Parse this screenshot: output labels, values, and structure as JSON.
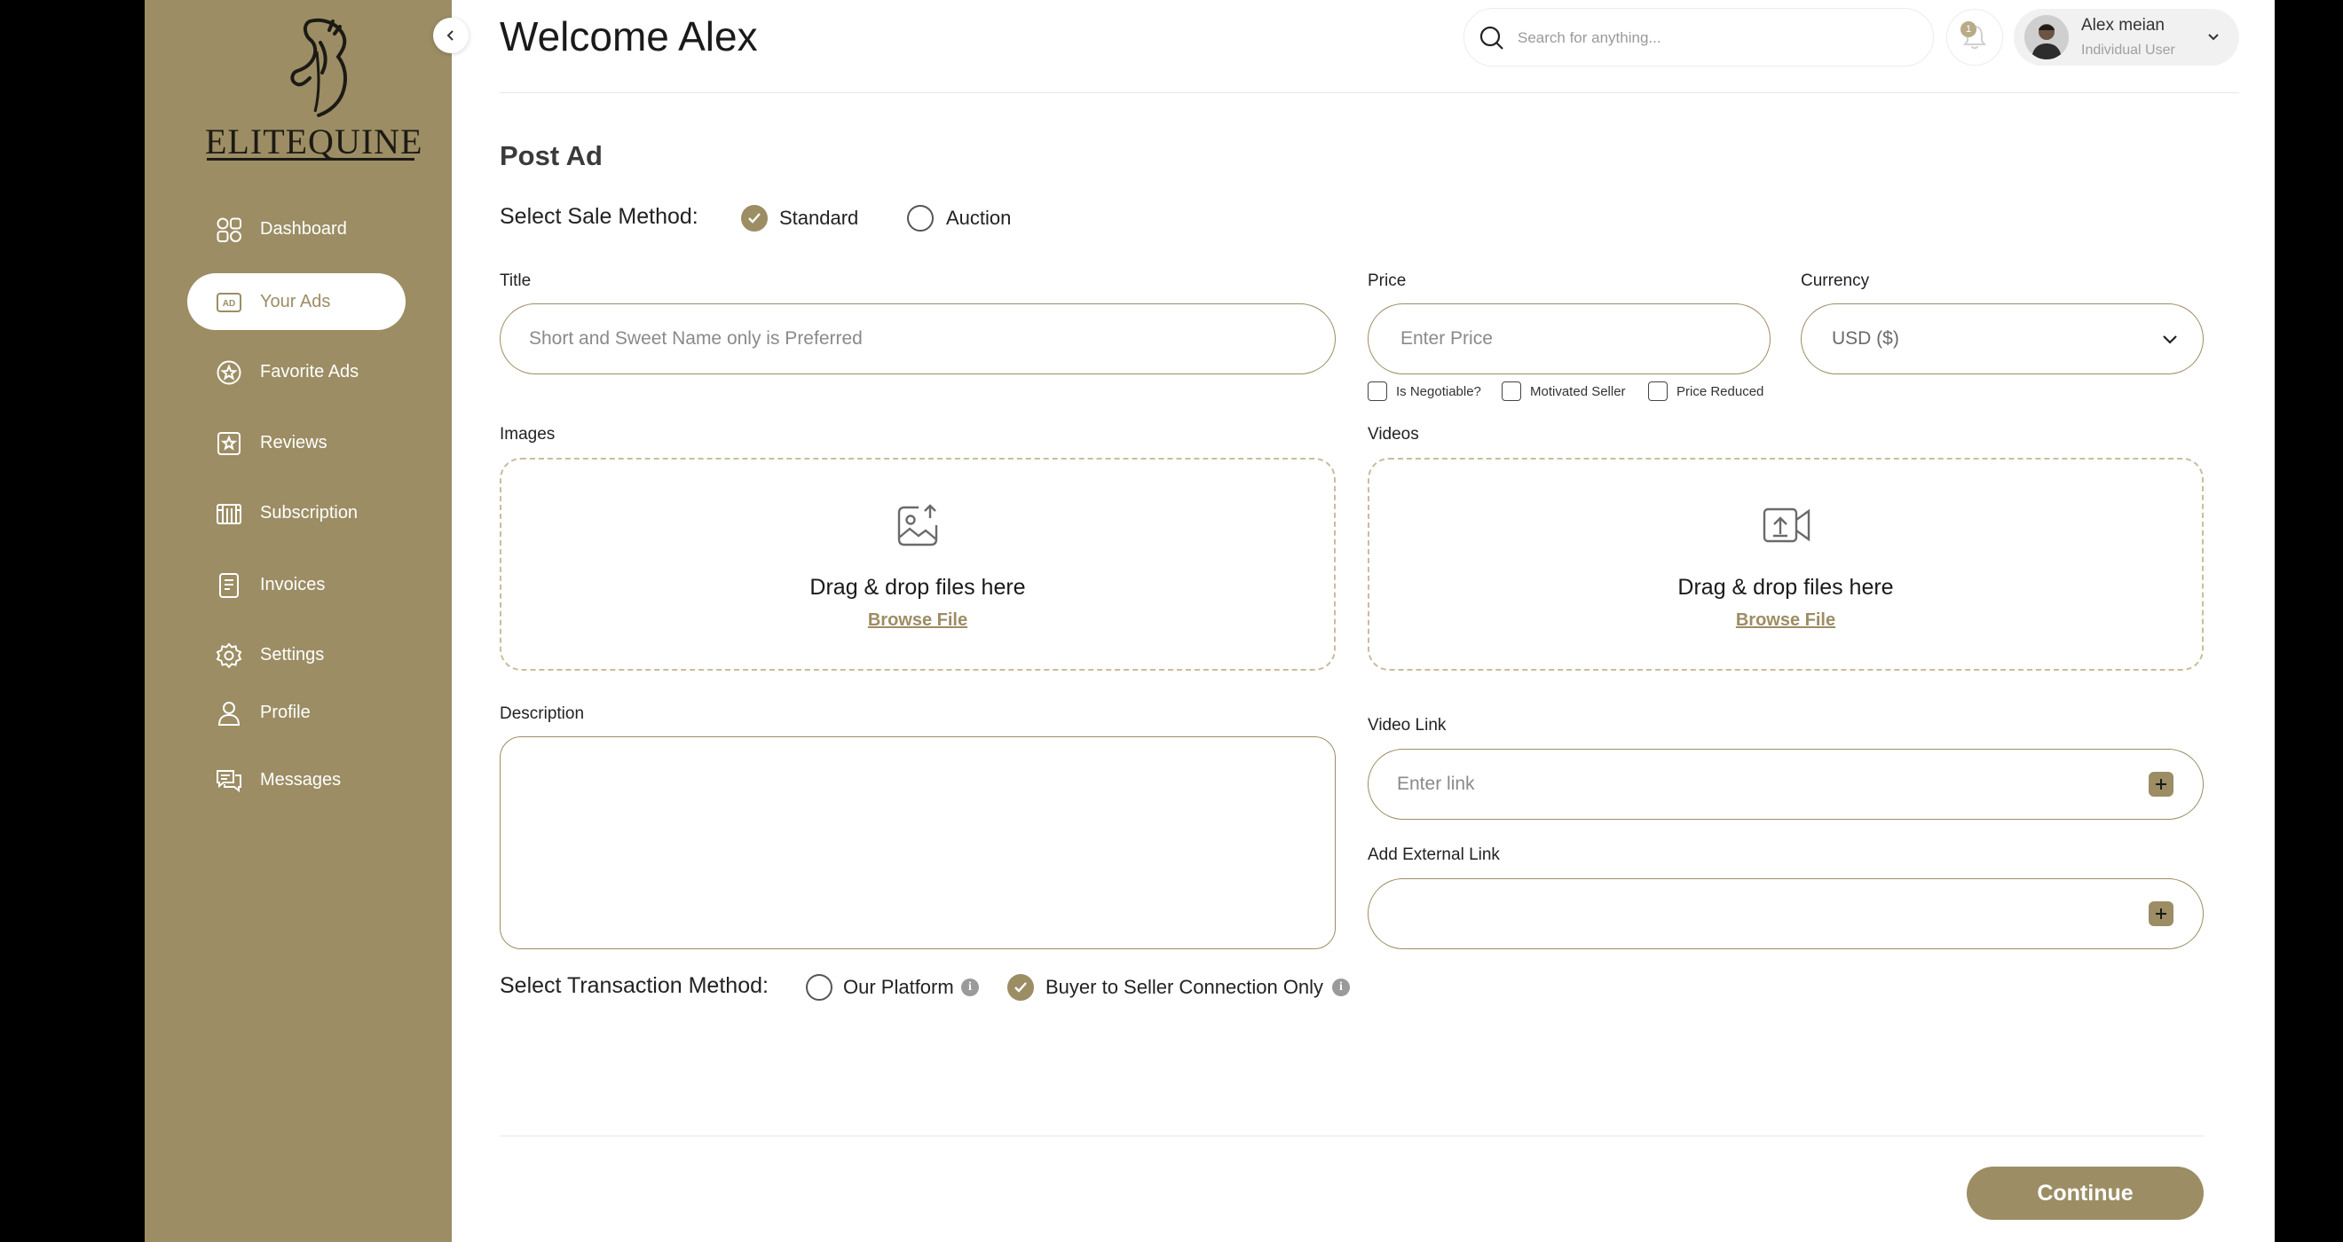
{
  "brand": {
    "logo_text": "ELITEQUINE",
    "accent": "#9c8d64"
  },
  "sidebar": {
    "items": [
      {
        "label": "Dashboard",
        "icon": "dashboard-icon",
        "active": false
      },
      {
        "label": "Your Ads",
        "icon": "ad-icon",
        "active": true
      },
      {
        "label": "Favorite Ads",
        "icon": "star-badge-icon",
        "active": false
      },
      {
        "label": "Reviews",
        "icon": "review-icon",
        "active": false
      },
      {
        "label": "Subscription",
        "icon": "subscription-icon",
        "active": false
      },
      {
        "label": "Invoices",
        "icon": "invoice-icon",
        "active": false
      },
      {
        "label": "Settings",
        "icon": "gear-icon",
        "active": false
      },
      {
        "label": "Profile",
        "icon": "user-icon",
        "active": false
      },
      {
        "label": "Messages",
        "icon": "messages-icon",
        "active": false
      }
    ]
  },
  "header": {
    "title": "Welcome Alex",
    "search_placeholder": "Search for anything...",
    "notification_count": "1",
    "user_name": "Alex meian",
    "user_role": "Individual User"
  },
  "form": {
    "heading": "Post Ad",
    "sale_method_label": "Select Sale Method:",
    "sale_methods": [
      {
        "label": "Standard",
        "checked": true
      },
      {
        "label": "Auction",
        "checked": false
      }
    ],
    "title_label": "Title",
    "title_placeholder": "Short and Sweet Name only is Preferred",
    "price_label": "Price",
    "price_placeholder": "Enter Price",
    "currency_label": "Currency",
    "currency_value": "USD ($)",
    "price_options": [
      {
        "label": "Is Negotiable?",
        "checked": false
      },
      {
        "label": "Motivated Seller",
        "checked": false
      },
      {
        "label": "Price Reduced",
        "checked": false
      }
    ],
    "images_label": "Images",
    "images_drop_text": "Drag & drop files here",
    "images_browse": "Browse File",
    "videos_label": "Videos",
    "videos_drop_text": "Drag & drop files here",
    "videos_browse": "Browse File",
    "description_label": "Description",
    "video_link_label": "Video Link",
    "video_link_placeholder": "Enter link",
    "external_link_label": "Add External Link",
    "transaction_label": "Select Transaction Method:",
    "transaction_methods": [
      {
        "label": "Our Platform",
        "checked": false
      },
      {
        "label": "Buyer to Seller Connection Only",
        "checked": true
      }
    ],
    "continue_label": "Continue"
  }
}
